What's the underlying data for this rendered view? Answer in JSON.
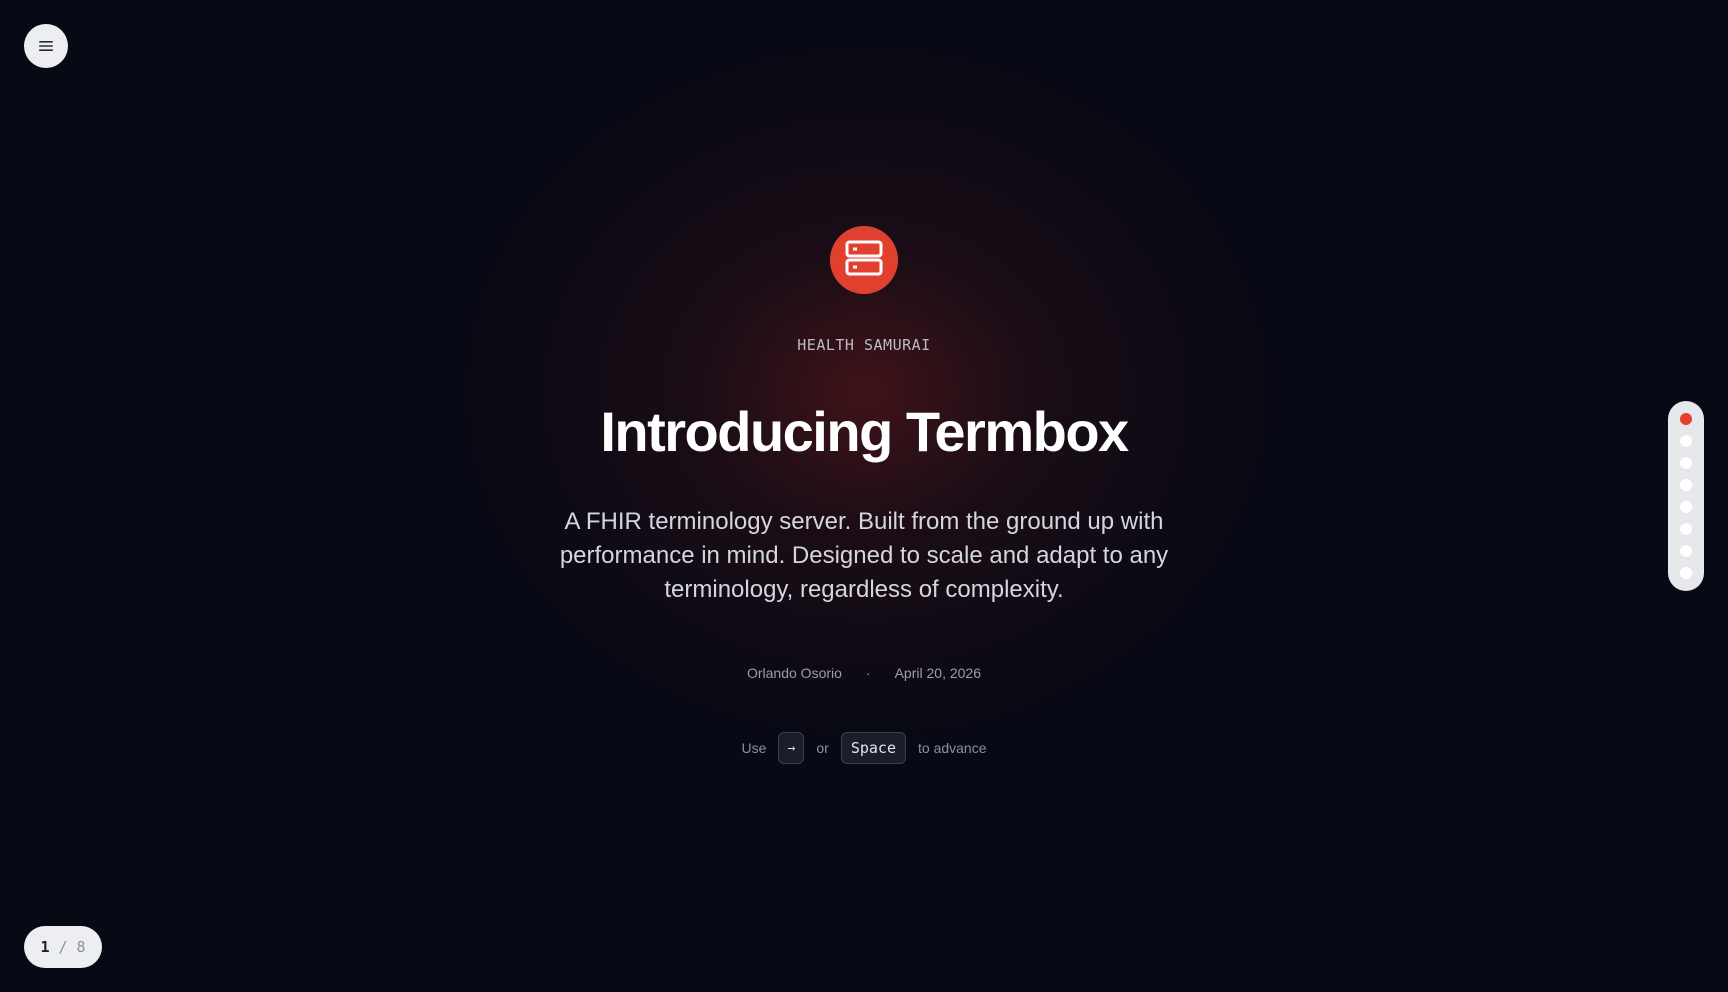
{
  "nav": {
    "menu_icon": "hamburger-menu-icon"
  },
  "slide": {
    "logo_icon": "server-icon",
    "eyebrow": "HEALTH SAMURAI",
    "title": "Introducing Termbox",
    "subtitle": "A FHIR terminology server. Built from the ground up with performance in mind. Designed to scale and adapt to any terminology, regardless of complexity.",
    "author": "Orlando Osorio",
    "separator": "·",
    "date": "April 20, 2026"
  },
  "hint": {
    "prefix": "Use",
    "key_arrow": "→",
    "or": "or",
    "key_space": "Space",
    "suffix": "to advance"
  },
  "progress": {
    "current": "1",
    "separator": "/",
    "total": "8",
    "active_index": 0,
    "dot_count": 8
  },
  "colors": {
    "accent": "#e2402f",
    "background": "#070914",
    "glow": "#6e1c1c"
  }
}
